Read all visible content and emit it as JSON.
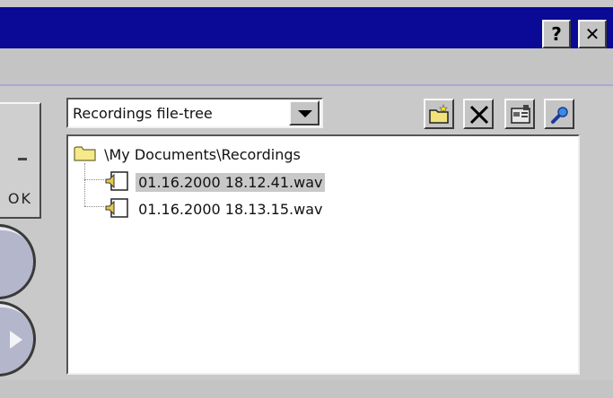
{
  "titlebar": {
    "help_label": "?",
    "close_label": "✕"
  },
  "left_panel": {
    "ok_label": "OK"
  },
  "dropdown": {
    "selected": "Recordings file-tree"
  },
  "toolbar": {
    "icons": [
      "new-folder-icon",
      "delete-icon",
      "properties-icon",
      "search-icon"
    ]
  },
  "tree": {
    "root": "\\My Documents\\Recordings",
    "files": [
      {
        "name": "01.16.2000 18.12.41.wav",
        "selected": true
      },
      {
        "name": "01.16.2000 18.13.15.wav",
        "selected": false
      }
    ]
  },
  "colors": {
    "titlebar": "#0a0a96",
    "face": "#c4c4c4",
    "selection": "#c8c8c8"
  }
}
